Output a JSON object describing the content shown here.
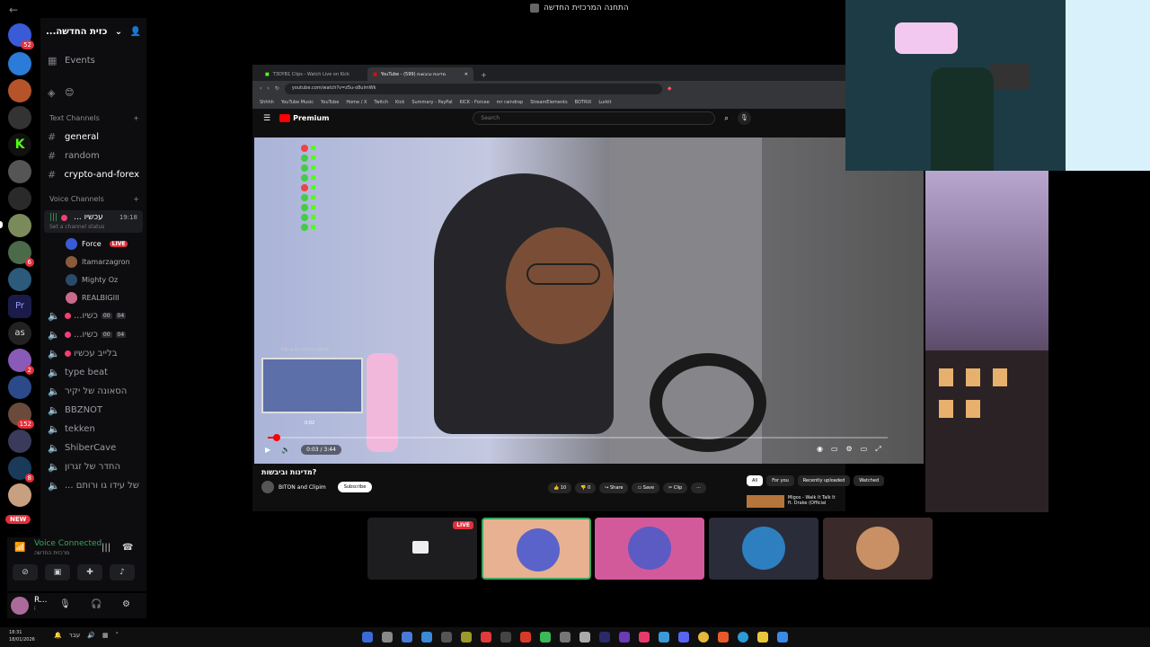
{
  "window_title": "התחנה המרכזית החדשה",
  "server": {
    "name": "...כזית החדשה",
    "events_label": "Events",
    "text_category": "Text Channels",
    "voice_category": "Voice Channels",
    "text_channels": [
      {
        "name": "general"
      },
      {
        "name": "random"
      },
      {
        "name": "crypto-and-forex"
      }
    ],
    "active_voice": {
      "name": "... עכשיו",
      "time": "19:18",
      "status": "Set a channel status",
      "members": [
        {
          "name": "Force",
          "live": "LIVE"
        },
        {
          "name": "Itamarzagron"
        },
        {
          "name": "Mighty Oz"
        },
        {
          "name": "REALBIGIII"
        }
      ]
    },
    "voice_channels": [
      {
        "name": "...כשיו",
        "c1": "00",
        "c2": "04"
      },
      {
        "name": "...כשיו",
        "c1": "00",
        "c2": "04"
      },
      {
        "name": "בלייב עכשיו"
      },
      {
        "name": "type beat"
      },
      {
        "name": "הסאונה של יקיר"
      },
      {
        "name": "BBZNOT"
      },
      {
        "name": "tekken"
      },
      {
        "name": "ShiberCave"
      },
      {
        "name": "החדר של זגרון"
      },
      {
        "name": "... של עידו גו ורותם"
      }
    ]
  },
  "rail": {
    "badges": [
      "52",
      "6",
      "2",
      "152",
      "8"
    ],
    "new_label": "NEW"
  },
  "voice_connection": {
    "title": "Voice Connected",
    "subtitle": "מרכזית החדשה"
  },
  "user": {
    "name": "R...",
    "status": "i"
  },
  "browser": {
    "tabs": [
      {
        "label": "T3DYB1 Clips - Watch Live on Kick"
      },
      {
        "label": "YouTube - מדינות וביבשות (599)"
      }
    ],
    "url": "youtube.com/watch?v=z5u-o8ulmWk",
    "bookmarks": [
      "Shhhh",
      "YouTube Music",
      "YouTube",
      "Home / X",
      "Twitch",
      "Kick",
      "Summary - PayPal",
      "KICK - Forcee",
      "mr raindrop",
      "StreamElements",
      "BOTRIX",
      "Lurkit"
    ]
  },
  "youtube": {
    "logo_text": "Premium",
    "search_placeholder": "Search",
    "video": {
      "title": "מדינות וביבשות?",
      "channel": "BITON and Clipim",
      "subscribe": "Subscribe",
      "time": "0:03 / 3:44",
      "seek_hint": "Pull up for precise seeking",
      "seek_time": "0:02",
      "progress_fraction": 0.014,
      "likes": "10",
      "dislikes": "0",
      "share": "Share",
      "save": "Save",
      "clip": "Clip"
    },
    "chips": [
      "All",
      "For you",
      "Recently uploaded",
      "Watched"
    ],
    "related": {
      "title": "Migos - Walk It Talk It ft. Drake (Official"
    }
  },
  "stage_tiles": [
    {
      "label": "LIVE",
      "color": "#1d1d1f",
      "avatar": "#222"
    },
    {
      "color": "#e8b191",
      "avatar": "#5a63c9"
    },
    {
      "color": "#d35a9a",
      "avatar": "#5c5bc4"
    },
    {
      "color": "#2b2c3a",
      "avatar": "#2e7fbf"
    },
    {
      "color": "#3a2a2a",
      "avatar": "#c89064"
    }
  ],
  "taskbar": {
    "time": "18:31",
    "date": "18/01/2026",
    "lang": "עבר"
  },
  "colors": {
    "discord_bg": "#000000",
    "youtube_red": "#ff0000",
    "live_red": "#e0303a",
    "voice_green": "#3ba55d"
  }
}
